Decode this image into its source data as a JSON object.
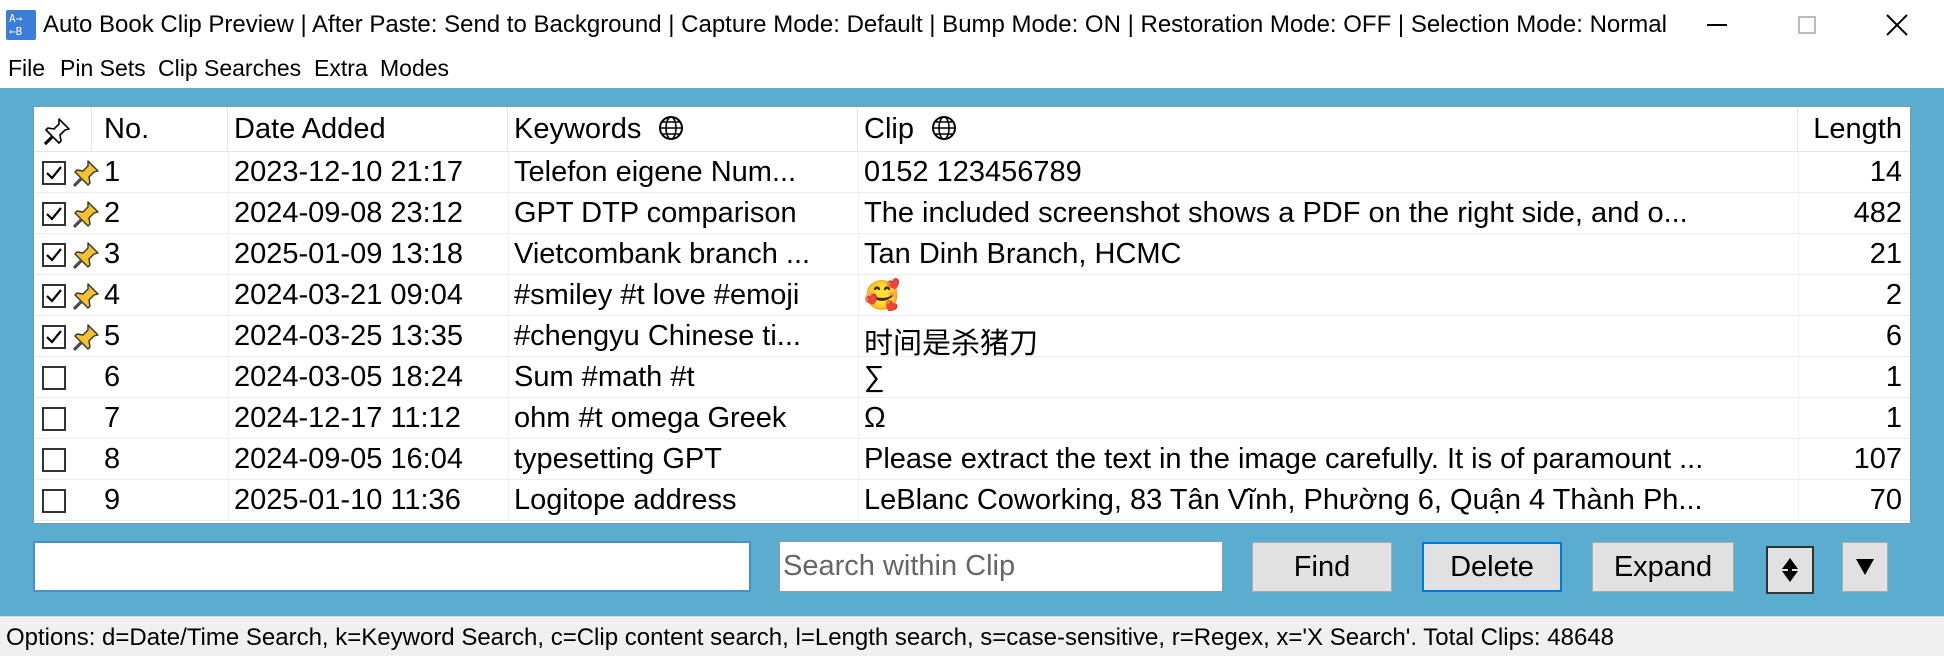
{
  "window": {
    "title": "Auto Book Clip Preview | After Paste: Send to Background | Capture Mode: Default | Bump Mode: ON | Restoration Mode: OFF | Selection Mode: Normal",
    "icon_name": "app-icon",
    "icon_text_top": "A→",
    "icon_text_bottom": "←B"
  },
  "menu": {
    "items": [
      "File",
      "Pin Sets",
      "Clip Searches",
      "Extra",
      "Modes"
    ]
  },
  "table": {
    "headers": {
      "pin": "pin-icon",
      "no": "No.",
      "date": "Date Added",
      "keywords": "Keywords",
      "clip": "Clip",
      "length": "Length"
    },
    "rows": [
      {
        "checked": true,
        "pinned": true,
        "no": "1",
        "date": "2023-12-10 21:17",
        "keywords": "Telefon eigene Num...",
        "clip": "0152 123456789",
        "length": "14"
      },
      {
        "checked": true,
        "pinned": true,
        "no": "2",
        "date": "2024-09-08 23:12",
        "keywords": "GPT DTP comparison",
        "clip": "The included screenshot shows a PDF on the right side, and o...",
        "length": "482"
      },
      {
        "checked": true,
        "pinned": true,
        "no": "3",
        "date": "2025-01-09 13:18",
        "keywords": "Vietcombank branch ...",
        "clip": "Tan Dinh Branch, HCMC",
        "length": "21"
      },
      {
        "checked": true,
        "pinned": true,
        "no": "4",
        "date": "2024-03-21 09:04",
        "keywords": "#smiley #t love #emoji",
        "clip": "🥰",
        "length": "2"
      },
      {
        "checked": true,
        "pinned": true,
        "no": "5",
        "date": "2024-03-25 13:35",
        "keywords": "#chengyu Chinese ti...",
        "clip": "时间是杀猪刀",
        "length": "6"
      },
      {
        "checked": false,
        "pinned": false,
        "no": "6",
        "date": "2024-03-05 18:24",
        "keywords": "Sum #math #t",
        "clip": "∑",
        "length": "1"
      },
      {
        "checked": false,
        "pinned": false,
        "no": "7",
        "date": "2024-12-17 11:12",
        "keywords": "ohm #t omega Greek",
        "clip": "Ω",
        "length": "1"
      },
      {
        "checked": false,
        "pinned": false,
        "no": "8",
        "date": "2024-09-05 16:04",
        "keywords": "typesetting GPT",
        "clip": "Please extract the text in the image carefully. It is of paramount ...",
        "length": "107"
      },
      {
        "checked": false,
        "pinned": false,
        "no": "9",
        "date": "2025-01-10 11:36",
        "keywords": "Logitope address",
        "clip": "LeBlanc Coworking, 83 Tân Vĩnh, Phường 6, Quận 4 Thành Ph...",
        "length": "70"
      }
    ]
  },
  "controls": {
    "main_input_value": "",
    "search_placeholder": "Search within Clip",
    "find_label": "Find",
    "delete_label": "Delete",
    "expand_label": "Expand",
    "up_icon": "eject-up-icon",
    "down_icon": "down-arrow-icon"
  },
  "status": {
    "text": "Options: d=Date/Time Search, k=Keyword Search, c=Clip content search, l=Length search, s=case-sensitive, r=Regex, x='X Search'. Total Clips: 48648"
  },
  "colors": {
    "body_background": "#5aadcf",
    "app_icon": "#3b7dd8",
    "focus_border": "#0078d7",
    "button_face": "#e1e1e1"
  }
}
